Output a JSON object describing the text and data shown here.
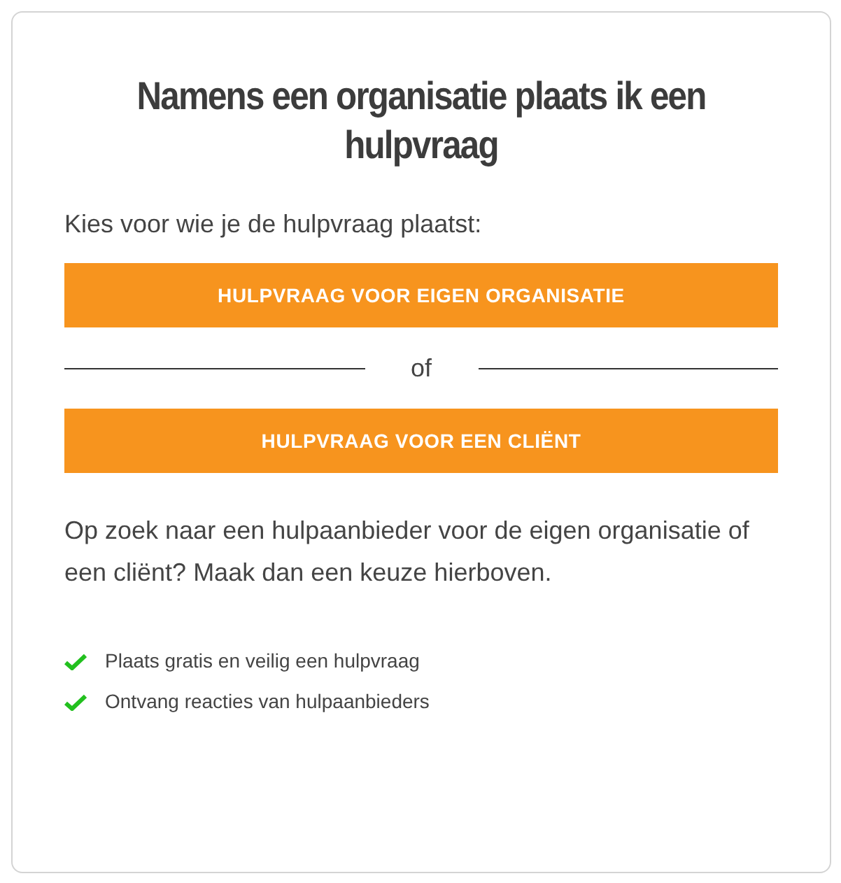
{
  "title": "Namens een organisatie plaats ik een hulpvraag",
  "intro": "Kies voor wie je de hulpvraag plaatst:",
  "buttons": [
    {
      "label": "HULPVRAAG VOOR EIGEN ORGANISATIE"
    },
    {
      "label": "HULPVRAAG VOOR EEN CLIËNT"
    }
  ],
  "separator": "of",
  "description": "Op zoek naar een hulpaanbieder voor de eigen organisatie of een cliënt? Maak dan een keuze hierboven.",
  "benefits": [
    "Plaats gratis en veilig een hulpvraag",
    "Ontvang reacties van hulpaanbieders"
  ]
}
